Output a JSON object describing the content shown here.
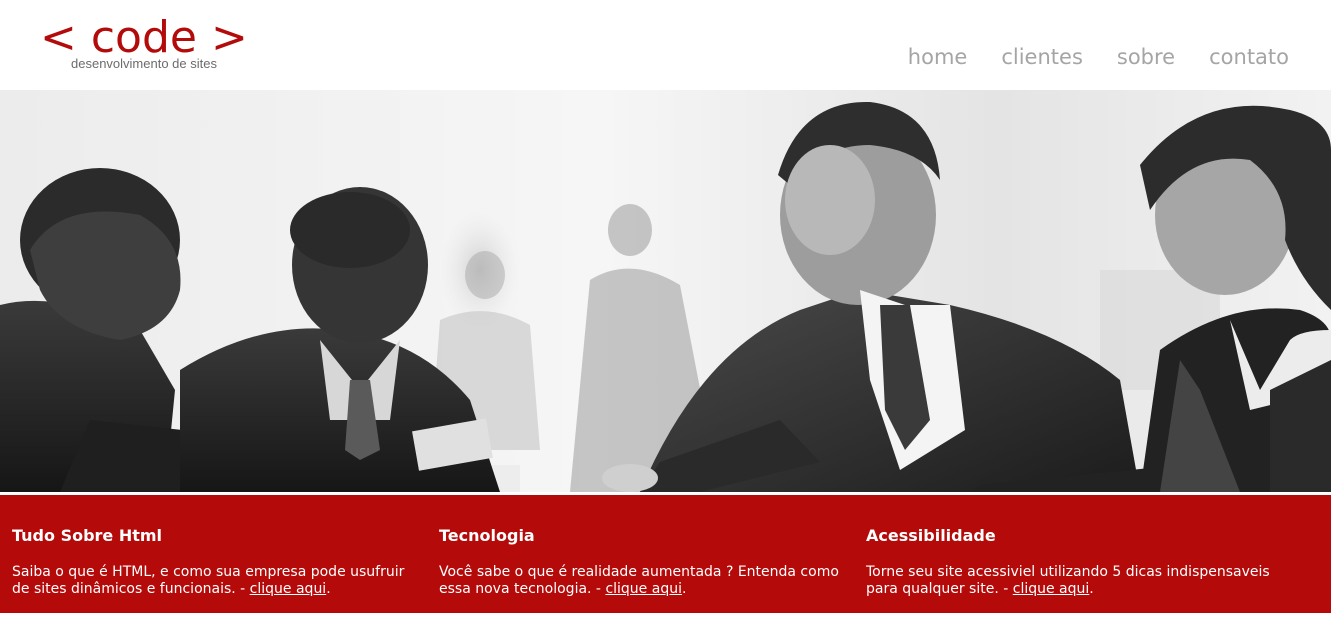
{
  "header": {
    "logo_main": "< code >",
    "logo_sub": "desenvolvimento de sites",
    "nav": [
      "home",
      "clientes",
      "sobre",
      "contato"
    ]
  },
  "hero": {
    "image": "business-people-handshake-photo"
  },
  "features": [
    {
      "title": "Tudo Sobre Html",
      "text": "Saiba o que é HTML, e como sua empresa pode usufruir de sites dinâmicos e funcionais. - ",
      "link": "clique aqui",
      "end": "."
    },
    {
      "title": "Tecnologia",
      "text": "Você sabe o que é realidade aumentada ? Entenda como essa nova tecnologia. - ",
      "link": "clique aqui",
      "end": "."
    },
    {
      "title": "Acessibilidade",
      "text": "Torne seu site acessiviel utilizando 5 dicas indispensaveis para qualquer site. - ",
      "link": "clique aqui",
      "end": "."
    }
  ],
  "colors": {
    "brand_red": "#b50a0a",
    "nav_gray": "#a5a5a5",
    "logo_sub_gray": "#6c6c6c"
  }
}
